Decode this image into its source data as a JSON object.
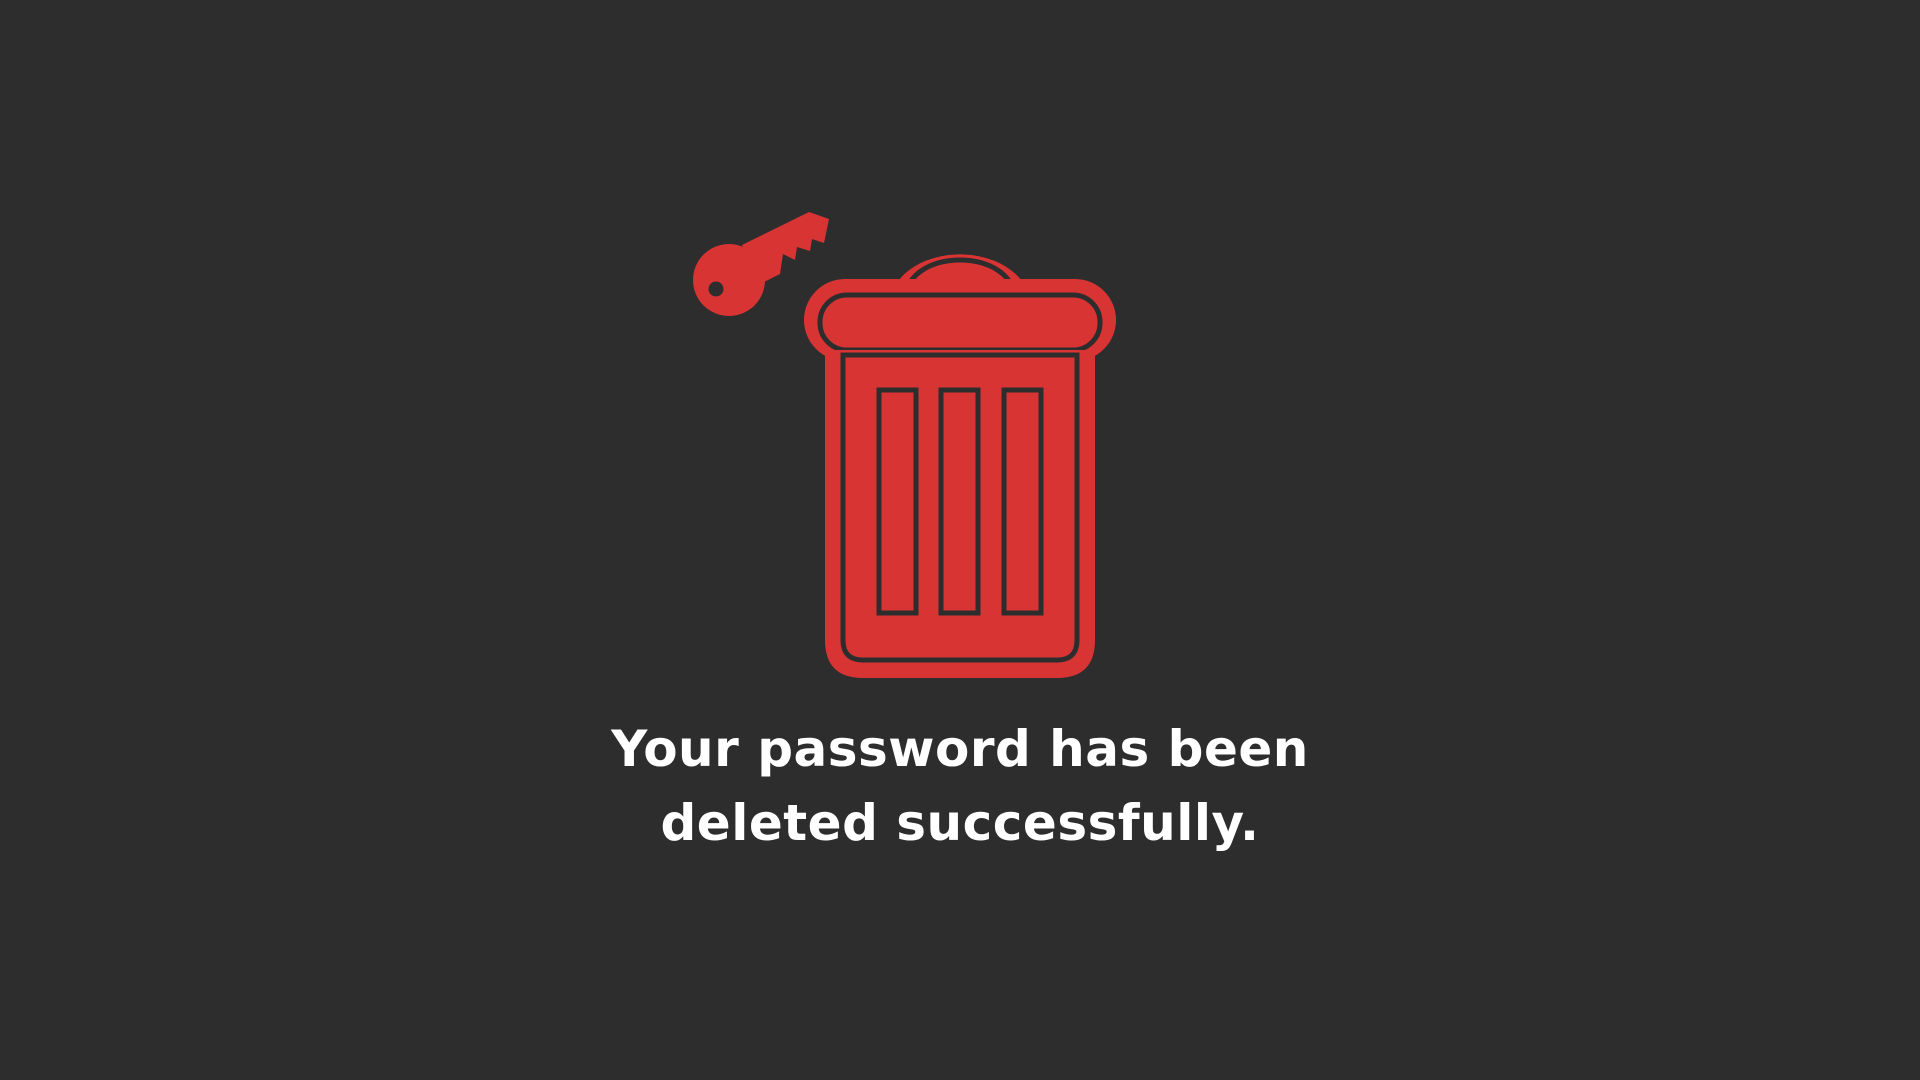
{
  "message": {
    "line1": "Your password has been",
    "line2": "deleted successfully."
  },
  "icons": {
    "trash": "trash-can-icon",
    "key": "key-icon"
  },
  "colors": {
    "background": "#2d2d2d",
    "accent": "#d93434",
    "text": "#ffffff"
  }
}
